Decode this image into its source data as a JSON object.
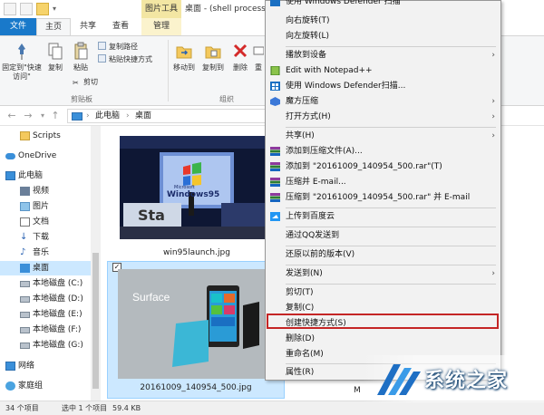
{
  "titlebar": {
    "context_tab_title": "图片工具",
    "window_title": "桌面 - (shell process..."
  },
  "tabs": {
    "file": "文件",
    "home": "主页",
    "share": "共享",
    "view": "查看",
    "manage": "管理"
  },
  "ribbon": {
    "pin": "固定到\"快速访问\"",
    "copy": "复制",
    "paste": "粘贴",
    "copy_path": "复制路径",
    "paste_shortcut": "粘贴快捷方式",
    "cut": "剪切",
    "clipboard_group": "剪贴板",
    "move_to": "移动到",
    "copy_to": "复制到",
    "delete": "删除",
    "rename": "重",
    "organize_group": "组织"
  },
  "address": {
    "this_pc": "此电脑",
    "desktop": "桌面"
  },
  "nav": {
    "items": [
      {
        "label": "Scripts",
        "icon": "folder-icon"
      },
      {
        "label": "OneDrive",
        "icon": "cloud-icon"
      },
      {
        "label": "此电脑",
        "icon": "computer-icon"
      },
      {
        "label": "视频",
        "icon": "video-icon"
      },
      {
        "label": "图片",
        "icon": "picture-icon"
      },
      {
        "label": "文档",
        "icon": "document-icon"
      },
      {
        "label": "下载",
        "icon": "download-icon"
      },
      {
        "label": "音乐",
        "icon": "music-icon"
      },
      {
        "label": "桌面",
        "icon": "desktop-icon"
      },
      {
        "label": "本地磁盘 (C:)",
        "icon": "drive-icon"
      },
      {
        "label": "本地磁盘 (D:)",
        "icon": "drive-icon"
      },
      {
        "label": "本地磁盘 (E:)",
        "icon": "drive-icon"
      },
      {
        "label": "本地磁盘 (F:)",
        "icon": "drive-icon"
      },
      {
        "label": "本地磁盘 (G:)",
        "icon": "drive-icon"
      },
      {
        "label": "网络",
        "icon": "network-icon"
      },
      {
        "label": "家庭组",
        "icon": "homegroup-icon"
      }
    ]
  },
  "content": {
    "file1": "win95launch.jpg",
    "file1_stage_text": "Windows95",
    "file1_stage_text2": "Microsoft",
    "file1_stage_text3": "Sta",
    "file2": "20161009_140954_500.jpg",
    "file2_brand": "Surface",
    "file3_partial": "M",
    "checkbox_mark": "✓"
  },
  "status": {
    "count": "34 个项目",
    "selected": "选中 1 个项目",
    "size": "59.4 KB"
  },
  "context_menu": {
    "items": [
      {
        "label": "使用 Windows Defender 扫描",
        "has_icon": true
      },
      {
        "label": "向右旋转(T)"
      },
      {
        "label": "向左旋转(L)"
      },
      {
        "label": "播放到设备",
        "submenu": true
      },
      {
        "label": "Edit with Notepad++",
        "has_icon": true
      },
      {
        "label": "使用 Windows Defender扫描...",
        "has_icon": true
      },
      {
        "label": "魔方压缩",
        "submenu": true,
        "has_icon": true
      },
      {
        "label": "打开方式(H)",
        "submenu": true
      },
      {
        "label": "共享(H)",
        "submenu": true
      },
      {
        "label": "添加到压缩文件(A)...",
        "has_icon": true
      },
      {
        "label": "添加到 \"20161009_140954_500.rar\"(T)",
        "has_icon": true
      },
      {
        "label": "压缩并 E-mail...",
        "has_icon": true
      },
      {
        "label": "压缩到 \"20161009_140954_500.rar\" 并 E-mail",
        "has_icon": true
      },
      {
        "label": "上传到百度云",
        "has_icon": true
      },
      {
        "label": "通过QQ发送到"
      },
      {
        "label": "还原以前的版本(V)"
      },
      {
        "label": "发送到(N)",
        "submenu": true
      },
      {
        "label": "剪切(T)"
      },
      {
        "label": "复制(C)"
      },
      {
        "label": "创建快捷方式(S)"
      },
      {
        "label": "删除(D)"
      },
      {
        "label": "重命名(M)"
      },
      {
        "label": "属性(R)"
      }
    ],
    "submenu_arrow": "›",
    "highlight_color": "#c42525"
  },
  "watermark": {
    "text": "系统之家"
  },
  "colors": {
    "file_tab": "#1979ca",
    "selection": "#cce8ff",
    "context_tab": "#f3e6a3"
  }
}
